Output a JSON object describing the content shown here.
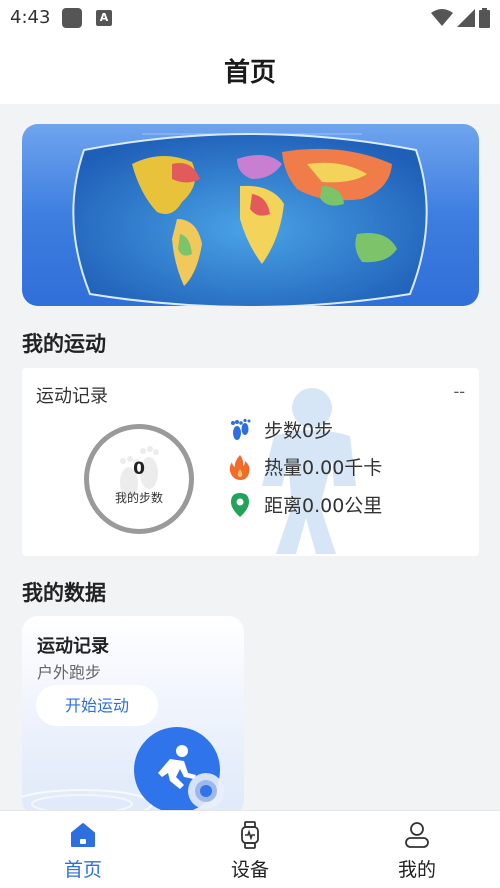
{
  "status_bar": {
    "time": "4:43",
    "a_badge": "A",
    "icons": [
      "notification-square-icon",
      "a-badge-icon",
      "wifi-icon",
      "signal-icon",
      "battery-icon"
    ]
  },
  "header": {
    "title": "首页"
  },
  "banner": {
    "image": "world-map"
  },
  "my_sport": {
    "section_title": "我的运动",
    "card_title": "运动记录",
    "card_right": "--",
    "steps_value": "0",
    "steps_label": "我的步数",
    "stats": [
      {
        "icon": "footprint-icon",
        "label": "步数0步"
      },
      {
        "icon": "flame-icon",
        "label": "热量0.00千卡"
      },
      {
        "icon": "location-pin-icon",
        "label": "距离0.00公里"
      }
    ]
  },
  "my_data": {
    "section_title": "我的数据",
    "card_title": "运动记录",
    "card_subtitle": "户外跑步",
    "start_button": "开始运动"
  },
  "bottom_nav": [
    {
      "label": "首页",
      "icon": "home-icon",
      "active": true
    },
    {
      "label": "设备",
      "icon": "watch-icon",
      "active": false
    },
    {
      "label": "我的",
      "icon": "person-icon",
      "active": false
    }
  ],
  "colors": {
    "accent": "#2e6fe0",
    "background": "#f2f3f5",
    "flame": "#f26b2c",
    "pin": "#23a35a"
  }
}
